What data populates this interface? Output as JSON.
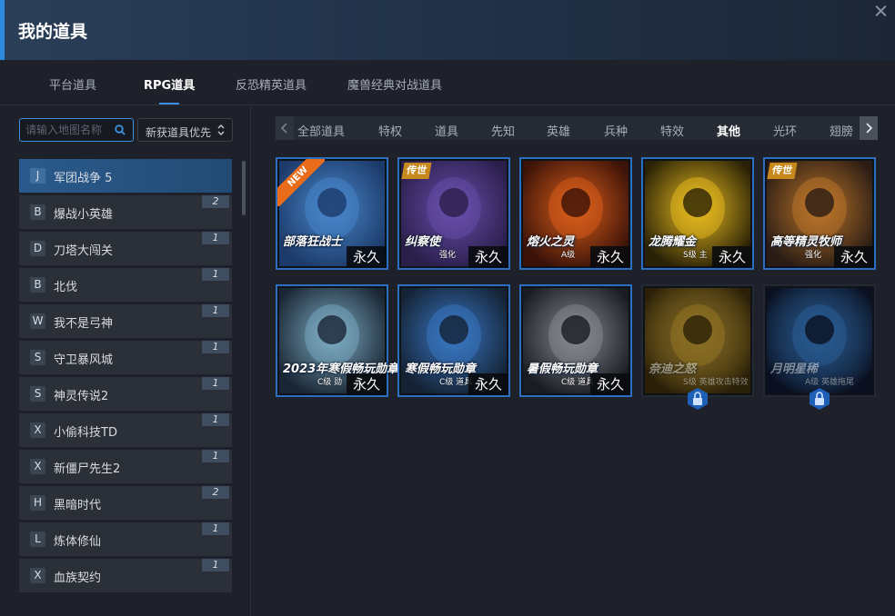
{
  "window": {
    "title": "我的道具"
  },
  "tabs": [
    {
      "label": "平台道具",
      "active": false
    },
    {
      "label": "RPG道具",
      "active": true
    },
    {
      "label": "反恐精英道具",
      "active": false
    },
    {
      "label": "魔兽经典对战道具",
      "active": false
    }
  ],
  "search": {
    "placeholder": "请输入地图名称",
    "value": ""
  },
  "sort": {
    "selected": "新获道具优先"
  },
  "maps": [
    {
      "letter": "J",
      "name": "军团战争 5",
      "count": "",
      "selected": true
    },
    {
      "letter": "B",
      "name": "爆战小英雄",
      "count": "2"
    },
    {
      "letter": "D",
      "name": "刀塔大闯关",
      "count": "1"
    },
    {
      "letter": "B",
      "name": "北伐",
      "count": "1"
    },
    {
      "letter": "W",
      "name": "我不是弓神",
      "count": "1"
    },
    {
      "letter": "S",
      "name": "守卫暴风城",
      "count": "1"
    },
    {
      "letter": "S",
      "name": "神灵传说2",
      "count": "1"
    },
    {
      "letter": "X",
      "name": "小偷科技TD",
      "count": "1"
    },
    {
      "letter": "X",
      "name": "新僵尸先生2",
      "count": "1"
    },
    {
      "letter": "H",
      "name": "黑暗时代",
      "count": "2"
    },
    {
      "letter": "L",
      "name": "炼体修仙",
      "count": "1"
    },
    {
      "letter": "X",
      "name": "血族契约",
      "count": "1"
    }
  ],
  "categories": [
    {
      "label": "全部道具"
    },
    {
      "label": "特权"
    },
    {
      "label": "道具"
    },
    {
      "label": "先知"
    },
    {
      "label": "英雄"
    },
    {
      "label": "兵种"
    },
    {
      "label": "特效"
    },
    {
      "label": "其他",
      "active": true
    },
    {
      "label": "光环"
    },
    {
      "label": "翅膀"
    }
  ],
  "items": [
    {
      "name": "部落狂战士",
      "sub": "",
      "badge": "NEW",
      "duration": "永久",
      "locked": false,
      "colors": [
        "#1c3a6a",
        "#4a8ad0"
      ]
    },
    {
      "name": "纠察使",
      "sub": "强化",
      "badge": "传世",
      "duration": "永久",
      "locked": false,
      "colors": [
        "#2a1e4a",
        "#6a4fb0"
      ]
    },
    {
      "name": "熔火之灵",
      "sub": "A级",
      "badge": "",
      "duration": "永久",
      "locked": false,
      "colors": [
        "#3a1208",
        "#e0601a"
      ]
    },
    {
      "name": "龙腾耀金",
      "sub": "S级 主",
      "badge": "",
      "duration": "永久",
      "locked": false,
      "colors": [
        "#2a2206",
        "#f0c020"
      ]
    },
    {
      "name": "高等精灵牧师",
      "sub": "强化",
      "badge": "传世",
      "duration": "永久",
      "locked": false,
      "colors": [
        "#2a1c14",
        "#c0782a"
      ]
    },
    {
      "name": "2023年寒假畅玩勋章",
      "sub": "C级 勋",
      "badge": "",
      "duration": "永久",
      "locked": false,
      "colors": [
        "#1a2634",
        "#7fb0c8"
      ]
    },
    {
      "name": "寒假畅玩勋章",
      "sub": "C级 道具",
      "badge": "",
      "duration": "永久",
      "locked": false,
      "colors": [
        "#142234",
        "#3a7ac8"
      ]
    },
    {
      "name": "暑假畅玩勋章",
      "sub": "C级 道具",
      "badge": "",
      "duration": "永久",
      "locked": false,
      "colors": [
        "#1a1c22",
        "#8a8e96"
      ]
    },
    {
      "name": "奈迪之怒",
      "sub": "S级 英雄攻击特效",
      "badge": "",
      "duration": "",
      "locked": true,
      "colors": [
        "#2a2008",
        "#e0b030"
      ]
    },
    {
      "name": "月明星稀",
      "sub": "A级 英雄拖尾",
      "badge": "",
      "duration": "",
      "locked": true,
      "colors": [
        "#0a1020",
        "#3a8ae0"
      ]
    }
  ],
  "accent": "#2a8be0"
}
